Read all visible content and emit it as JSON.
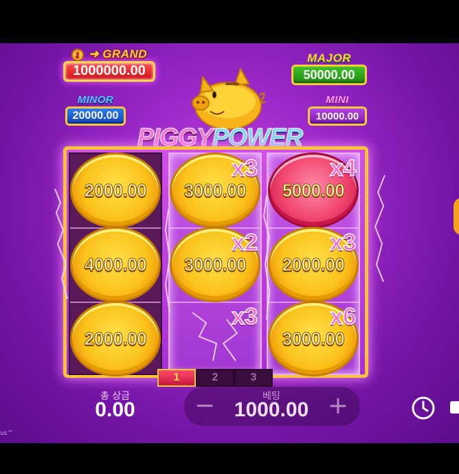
{
  "jackpots": {
    "grand": {
      "label": "GRAND",
      "coin_mark": "1",
      "value": "1000000.00"
    },
    "major": {
      "label": "MAJOR",
      "value": "50000.00"
    },
    "minor": {
      "label": "MINOR",
      "value": "20000.00"
    },
    "mini": {
      "label": "MINI",
      "value": "10000.00"
    }
  },
  "logo": {
    "part1": "PIGGY",
    "part2": "POWER"
  },
  "grid": {
    "reels": [
      {
        "lit": false,
        "cells": [
          {
            "value": "2000.00",
            "type": "gold",
            "mult": ""
          },
          {
            "value": "4000.00",
            "type": "gold",
            "mult": ""
          },
          {
            "value": "2000.00",
            "type": "gold",
            "mult": ""
          }
        ]
      },
      {
        "lit": true,
        "cells": [
          {
            "value": "3000.00",
            "type": "gold",
            "mult": "x3"
          },
          {
            "value": "3000.00",
            "type": "gold",
            "mult": "x2"
          },
          {
            "value": "",
            "type": "empty",
            "mult": "x3"
          }
        ]
      },
      {
        "lit": true,
        "cells": [
          {
            "value": "5000.00",
            "type": "red",
            "mult": "x4"
          },
          {
            "value": "2000.00",
            "type": "gold",
            "mult": "x3"
          },
          {
            "value": "3000.00",
            "type": "gold",
            "mult": "x6"
          }
        ]
      }
    ]
  },
  "pages": {
    "items": [
      "1",
      "2",
      "3"
    ],
    "active": 0
  },
  "total_win": {
    "label": "총 상금",
    "value": "0.00"
  },
  "bet": {
    "label": "베팅",
    "value": "1000.00",
    "minus": "−",
    "plus": "+"
  },
  "footer": {
    "text": "us™"
  },
  "icons": {
    "clock": "clock-icon"
  },
  "colors": {
    "accent": "#ffc43a",
    "background": "#9a28c8"
  }
}
